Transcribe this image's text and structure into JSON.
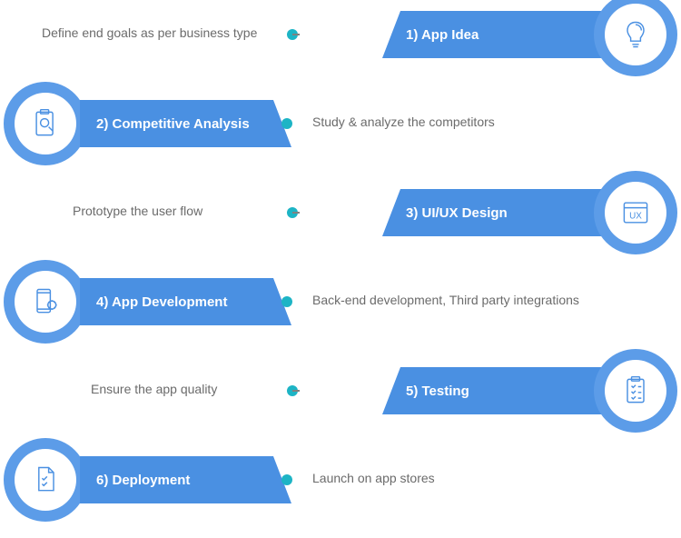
{
  "steps": [
    {
      "title": "1) App Idea",
      "desc": "Define end goals as per business type",
      "icon": "lightbulb-brain-icon"
    },
    {
      "title": "2) Competitive Analysis",
      "desc": "Study & analyze the competitors",
      "icon": "clipboard-search-icon"
    },
    {
      "title": "3) UI/UX Design",
      "desc": "Prototype the user flow",
      "icon": "ux-browser-icon"
    },
    {
      "title": "4) App Development",
      "desc": "Back-end development, Third party integrations",
      "icon": "phone-gear-icon"
    },
    {
      "title": "5) Testing",
      "desc": "Ensure the app quality",
      "icon": "checklist-clipboard-icon"
    },
    {
      "title": "6) Deployment",
      "desc": "Launch on app stores",
      "icon": "document-check-icon"
    }
  ]
}
